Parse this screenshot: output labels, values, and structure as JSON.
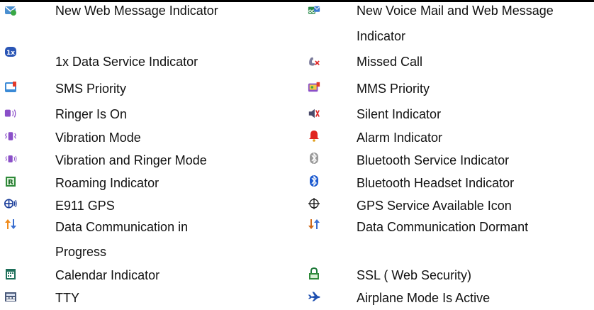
{
  "left_column": [
    {
      "label": "New Web Message Indicator",
      "icon": "web-message-icon"
    },
    {
      "label": "1x Data Service Indicator",
      "icon": "1x-data-icon"
    },
    {
      "label": "SMS Priority",
      "icon": "sms-priority-icon"
    },
    {
      "label": "Ringer Is On",
      "icon": "ringer-on-icon"
    },
    {
      "label": "Vibration Mode",
      "icon": "vibration-icon"
    },
    {
      "label": "Vibration and Ringer Mode",
      "icon": "vibration-ringer-icon"
    },
    {
      "label": "Roaming Indicator",
      "icon": "roaming-icon"
    },
    {
      "label": "E911 GPS",
      "icon": "e911-gps-icon"
    },
    {
      "label": "Data Communication in",
      "label_line2": "Progress",
      "icon": "data-progress-icon"
    },
    {
      "label": "Calendar Indicator",
      "icon": "calendar-icon"
    },
    {
      "label": "TTY",
      "icon": "tty-icon"
    }
  ],
  "right_column": [
    {
      "label": "New Voice Mail and Web Message",
      "label_line2": "Indicator",
      "icon": "voicemail-web-icon"
    },
    {
      "label": "Missed Call",
      "icon": "missed-call-icon"
    },
    {
      "label": "MMS Priority",
      "icon": "mms-priority-icon"
    },
    {
      "label": "Silent Indicator",
      "icon": "silent-icon"
    },
    {
      "label": "Alarm Indicator",
      "icon": "alarm-icon"
    },
    {
      "label": "Bluetooth Service Indicator",
      "icon": "bluetooth-service-icon"
    },
    {
      "label": "Bluetooth Headset Indicator",
      "icon": "bluetooth-headset-icon"
    },
    {
      "label": "GPS Service Available Icon",
      "icon": "gps-crosshair-icon"
    },
    {
      "label": "Data Communication Dormant",
      "icon": "data-dormant-icon"
    },
    {
      "label": "SSL ( Web Security)",
      "icon": "ssl-lock-icon"
    },
    {
      "label": "Airplane Mode Is Active",
      "icon": "airplane-icon"
    }
  ]
}
